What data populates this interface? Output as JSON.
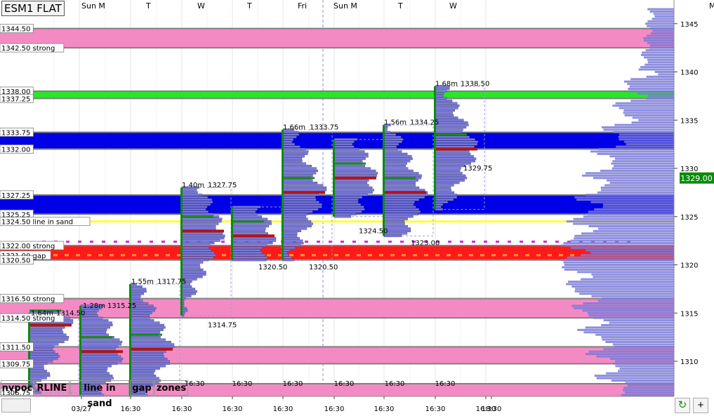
{
  "window": {
    "title": "ESM1 FLAT",
    "corner_label": "M"
  },
  "colors": {
    "pink_zone": "#f48ac4",
    "blue_zone": "#0000e6",
    "green_zone": "#28e628",
    "red_zone": "#ff1a1a",
    "yellow_line": "#ffff33",
    "profile_fill": "#7a7ad8",
    "price_marker": "#0a8c0a"
  },
  "toolbar": {
    "buttons": [
      {
        "label": "nvpoc",
        "bg": "#ff33cc"
      },
      {
        "label": "RLINE",
        "bg": "#f0f0f0"
      },
      {
        "label": "line in sand",
        "bg": "#ffff33"
      },
      {
        "label": "gap",
        "bg": "#ff8c1a"
      },
      {
        "label": "zones",
        "bg": "#f0f0f0"
      }
    ],
    "refresh_icon": "↻",
    "plus_label": "+"
  },
  "chart_data": {
    "type": "volume-profile",
    "title": "ESM1 FLAT",
    "ylim": [
      1305,
      1346.5
    ],
    "yticks": [
      1310,
      1315,
      1320,
      1325,
      1330,
      1335,
      1340,
      1345
    ],
    "day_labels": [
      "Sun M",
      "T",
      "W",
      "T",
      "Fri",
      "Sun M",
      "T",
      "W"
    ],
    "time_labels": [
      "03/27",
      "16:30",
      "16:30",
      "16:30",
      "16:30",
      "16:30",
      "16:30",
      "16:30",
      "16:30",
      "18:30"
    ],
    "profile_time_labels": [
      "16:30",
      "16:30",
      "16:30",
      "16:30",
      "16:30",
      "16:30"
    ],
    "last_price": "1329.00",
    "zones": [
      {
        "label": "1344.50",
        "top": 1344.5,
        "bottom": 1342.5,
        "color": "pink"
      },
      {
        "label": "1342.50 strong",
        "price": 1342.5
      },
      {
        "label": "1338.00",
        "top": 1338.0,
        "bottom": 1337.25,
        "color": "green"
      },
      {
        "label": "1337.25",
        "price": 1337.25
      },
      {
        "label": "1333.75",
        "top": 1333.75,
        "bottom": 1332.0,
        "color": "blue"
      },
      {
        "label": "1332.00",
        "price": 1332.0
      },
      {
        "label": "1327.25",
        "top": 1327.25,
        "bottom": 1325.25,
        "color": "blue"
      },
      {
        "label": "1325.25",
        "price": 1325.25
      },
      {
        "label": "1324.50 line in sand",
        "price": 1324.5,
        "color": "yellow"
      },
      {
        "label": "1322.00 strong",
        "top": 1322.0,
        "bottom": 1320.5,
        "color": "red"
      },
      {
        "label": "1321.00 gap",
        "price": 1321.0
      },
      {
        "label": "1320.50",
        "price": 1320.5
      },
      {
        "label": "1316.50 strong",
        "top": 1316.5,
        "bottom": 1314.5,
        "color": "pink"
      },
      {
        "label": "1314.50 strong",
        "price": 1314.5
      },
      {
        "label": "1311.50",
        "top": 1311.5,
        "bottom": 1309.75,
        "color": "pink"
      },
      {
        "label": "1309.75",
        "price": 1309.75
      },
      {
        "label": "1306.75",
        "price": 1306.75
      }
    ],
    "annotations": [
      {
        "text": "1.64m",
        "price": 1315.0
      },
      {
        "text": "1314.50",
        "price": 1315.0
      },
      {
        "text": "1.28m",
        "price": 1315.75
      },
      {
        "text": "1315.25",
        "price": 1315.75
      },
      {
        "text": "1.55m",
        "price": 1318.25
      },
      {
        "text": "1317.75",
        "price": 1318.25
      },
      {
        "text": "1314.75",
        "price": 1313.75
      },
      {
        "text": "1.40m",
        "price": 1328.25
      },
      {
        "text": "1327.75",
        "price": 1328.25
      },
      {
        "text": "1.66m",
        "price": 1334.25
      },
      {
        "text": "1333.75",
        "price": 1334.25
      },
      {
        "text": "1.56m",
        "price": 1334.75
      },
      {
        "text": "1334.25",
        "price": 1334.75
      },
      {
        "text": "1.68m",
        "price": 1338.75
      },
      {
        "text": "1338.50",
        "price": 1338.75
      },
      {
        "text": "1329.75",
        "price": 1330.0
      },
      {
        "text": "1324.50",
        "price": 1323.5
      },
      {
        "text": "1323.00",
        "price": 1322.25
      },
      {
        "text": "1320.50",
        "price": 1319.75
      },
      {
        "text": "1320.50",
        "price": 1319.75
      }
    ],
    "daily_profiles": [
      {
        "low": 1306.75,
        "high": 1315.0,
        "poc": 1313.75
      },
      {
        "low": 1305.5,
        "high": 1315.75,
        "poc": 1311.0
      },
      {
        "low": 1305.5,
        "high": 1318.0,
        "poc": 1311.25
      },
      {
        "low": 1314.75,
        "high": 1328.0,
        "poc": 1323.5
      },
      {
        "low": 1320.5,
        "high": 1326.0,
        "poc": 1323.0
      },
      {
        "low": 1320.5,
        "high": 1334.0,
        "poc": 1327.5
      },
      {
        "low": 1325.0,
        "high": 1333.0,
        "poc": 1329.0
      },
      {
        "low": 1323.0,
        "high": 1334.5,
        "poc": 1327.5
      },
      {
        "low": 1325.75,
        "high": 1338.5,
        "poc": 1332.0
      }
    ],
    "composite_profile": {
      "low": 1305.5,
      "high": 1346.5,
      "peak": 1320.5
    }
  }
}
